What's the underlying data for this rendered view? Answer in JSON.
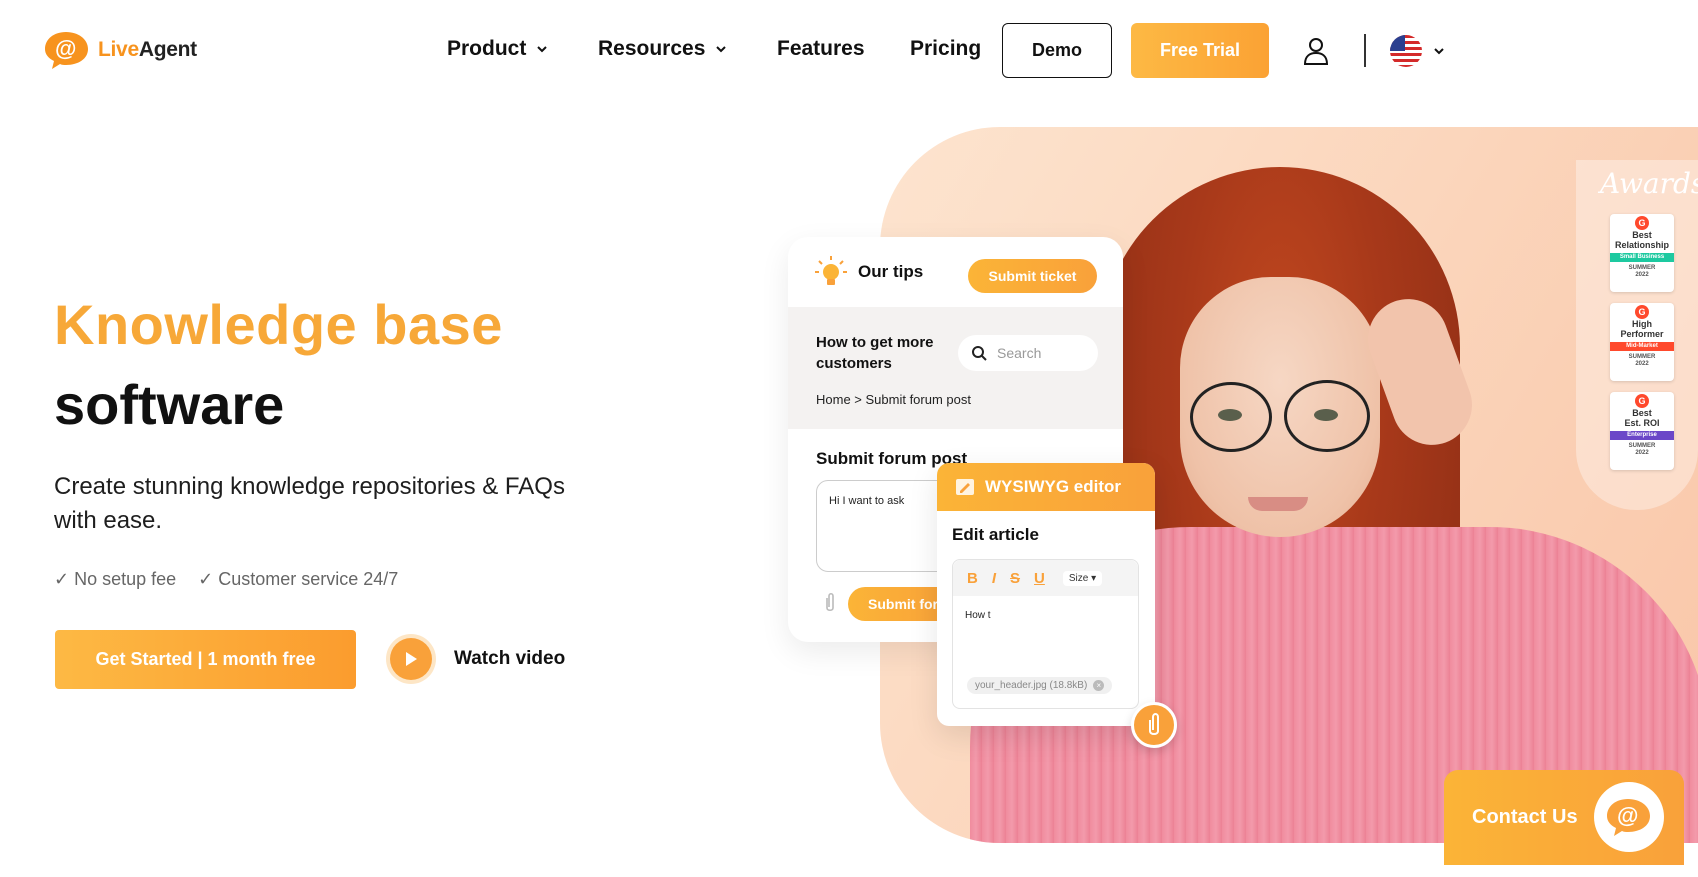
{
  "brand": {
    "name_part1": "Live",
    "name_part2": "Agent",
    "color": "#f7931e"
  },
  "nav": {
    "items": [
      {
        "label": "Product",
        "has_dropdown": true
      },
      {
        "label": "Resources",
        "has_dropdown": true
      },
      {
        "label": "Features",
        "has_dropdown": false
      },
      {
        "label": "Pricing",
        "has_dropdown": false
      }
    ],
    "demo_label": "Demo",
    "trial_label": "Free Trial",
    "icons": {
      "user": "user-icon",
      "language": "us-flag-icon"
    }
  },
  "hero": {
    "title_line1": "Knowledge base",
    "title_line2": "software",
    "subtitle": "Create stunning knowledge repositories & FAQs with ease.",
    "checks": [
      "✓ No setup fee",
      "✓ Customer service 24/7"
    ],
    "cta_label": "Get Started | 1 month free",
    "watch_label": "Watch video"
  },
  "awards": {
    "title": "Awards",
    "badges": [
      {
        "lines": [
          "Best",
          "Relationship"
        ],
        "category": "Small Business",
        "season": "SUMMER",
        "year": "2022",
        "strip_color": "#1dc9a0"
      },
      {
        "lines": [
          "High",
          "Performer"
        ],
        "category": "Mid-Market",
        "season": "SUMMER",
        "year": "2022",
        "strip_color": "#ff492c"
      },
      {
        "lines": [
          "Best",
          "Est. ROI"
        ],
        "category": "Enterprise",
        "season": "SUMMER",
        "year": "2022",
        "strip_color": "#6b47c8"
      }
    ]
  },
  "forum_card": {
    "tips_label": "Our tips",
    "ticket_label": "Submit ticket",
    "howto": "How to get more customers",
    "search_placeholder": "Search",
    "breadcrumb": "Home > Submit forum post",
    "submit_title": "Submit forum post",
    "textarea_value": "Hi I want to ask",
    "submit_label": "Submit forum post"
  },
  "editor_card": {
    "header": "WYSIWYG editor",
    "title": "Edit article",
    "toolbar": {
      "bold": "B",
      "italic": "I",
      "strike": "S",
      "underline": "U",
      "size": "Size"
    },
    "text": "How t",
    "file": "your_header.jpg (18.8kB)"
  },
  "contact": {
    "label": "Contact Us"
  },
  "colors": {
    "accent": "#f9a13a",
    "accent_light": "#fdb944",
    "text": "#111111"
  }
}
